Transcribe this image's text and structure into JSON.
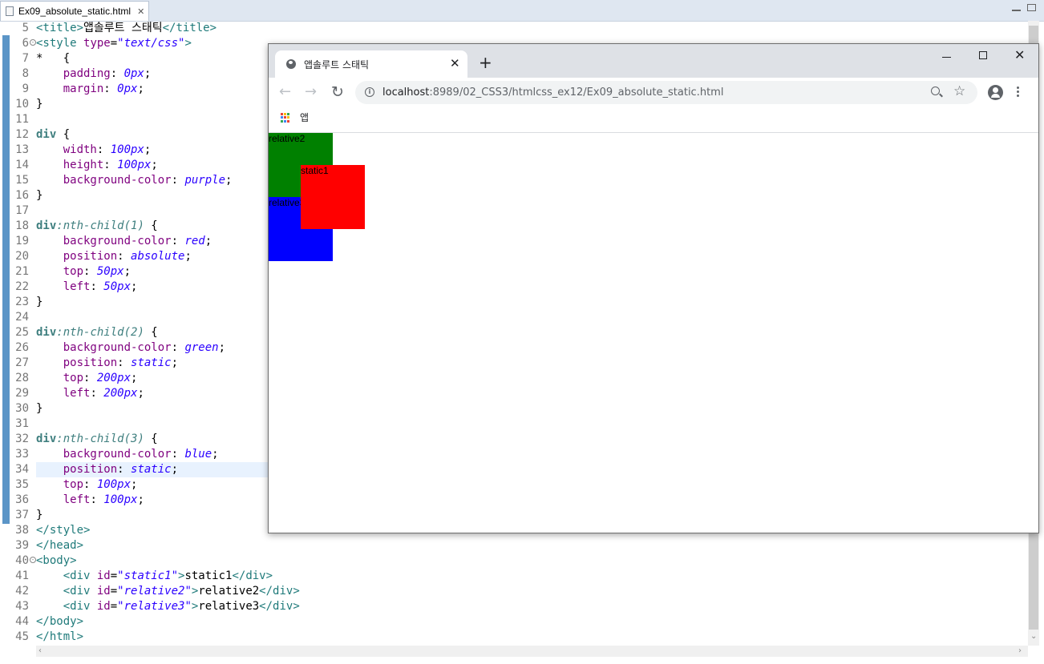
{
  "editor": {
    "tab_name": "Ex09_absolute_static.html",
    "line_numbers": [
      "5",
      "6",
      "7",
      "8",
      "9",
      "10",
      "11",
      "12",
      "13",
      "14",
      "15",
      "16",
      "17",
      "18",
      "19",
      "20",
      "21",
      "22",
      "23",
      "24",
      "25",
      "26",
      "27",
      "28",
      "29",
      "30",
      "31",
      "32",
      "33",
      "34",
      "35",
      "36",
      "37",
      "38",
      "39",
      "40",
      "41",
      "42",
      "43",
      "44",
      "45"
    ]
  },
  "code_text": {
    "l5a": "<title>",
    "l5b": "앱솔루트 스태틱",
    "l5c": "</title>",
    "l6a": "<style ",
    "l6b": "type",
    "l6c": "=",
    "l6d": "\"text/css\"",
    "l6e": ">",
    "l7": "*   {",
    "l8a": "    padding",
    "l8b": ": ",
    "l8c": "0px",
    "l8d": ";",
    "l9a": "    margin",
    "l9b": ": ",
    "l9c": "0px",
    "l9d": ";",
    "l10": "}",
    "l12a": "div",
    "l12b": " {",
    "l13a": "    width",
    "l13b": ": ",
    "l13c": "100px",
    "l13d": ";",
    "l14a": "    height",
    "l14b": ": ",
    "l14c": "100px",
    "l14d": ";",
    "l15a": "    background-color",
    "l15b": ": ",
    "l15c": "purple",
    "l15d": ";",
    "l16": "}",
    "l18a": "div",
    "l18b": ":nth-child(1)",
    "l18c": " {",
    "l19a": "    background-color",
    "l19b": ": ",
    "l19c": "red",
    "l19d": ";",
    "l20a": "    position",
    "l20b": ": ",
    "l20c": "absolute",
    "l20d": ";",
    "l21a": "    top",
    "l21b": ": ",
    "l21c": "50px",
    "l21d": ";",
    "l22a": "    left",
    "l22b": ": ",
    "l22c": "50px",
    "l22d": ";",
    "l23": "}",
    "l25a": "div",
    "l25b": ":nth-child(2)",
    "l25c": " {",
    "l26a": "    background-color",
    "l26b": ": ",
    "l26c": "green",
    "l26d": ";",
    "l27a": "    position",
    "l27b": ": ",
    "l27c": "static",
    "l27d": ";",
    "l28a": "    top",
    "l28b": ": ",
    "l28c": "200px",
    "l28d": ";",
    "l29a": "    left",
    "l29b": ": ",
    "l29c": "200px",
    "l29d": ";",
    "l30": "}",
    "l32a": "div",
    "l32b": ":nth-child(3)",
    "l32c": " {",
    "l33a": "    background-color",
    "l33b": ": ",
    "l33c": "blue",
    "l33d": ";",
    "l34a": "    position",
    "l34b": ": ",
    "l34c": "static",
    "l34d": ";",
    "l35a": "    top",
    "l35b": ": ",
    "l35c": "100px",
    "l35d": ";",
    "l36a": "    left",
    "l36b": ": ",
    "l36c": "100px",
    "l36d": ";",
    "l37": "}",
    "l38": "</style>",
    "l39": "</head>",
    "l40": "<body>",
    "l41a": "    <div ",
    "l41b": "id",
    "l41c": "=",
    "l41d": "\"static1\"",
    "l41e": ">",
    "l41f": "static1",
    "l41g": "</div>",
    "l42a": "    <div ",
    "l42b": "id",
    "l42c": "=",
    "l42d": "\"relative2\"",
    "l42e": ">",
    "l42f": "relative2",
    "l42g": "</div>",
    "l43a": "    <div ",
    "l43b": "id",
    "l43c": "=",
    "l43d": "\"relative3\"",
    "l43e": ">",
    "l43f": "relative3",
    "l43g": "</div>",
    "l44": "</body>",
    "l45": "</html>"
  },
  "browser": {
    "tab_title": "앱솔루트 스태틱",
    "tab_close": "✕",
    "new_tab": "+",
    "url_host": "localhost",
    "url_rest": ":8989/02_CSS3/htmlcss_ex12/Ex09_absolute_static.html",
    "bookmark_label": "앱",
    "boxes": [
      {
        "label": "relative2",
        "color": "#008000"
      },
      {
        "label": "static1",
        "color": "#ff0000"
      },
      {
        "label": "relative3",
        "color": "#0000ff"
      }
    ]
  }
}
